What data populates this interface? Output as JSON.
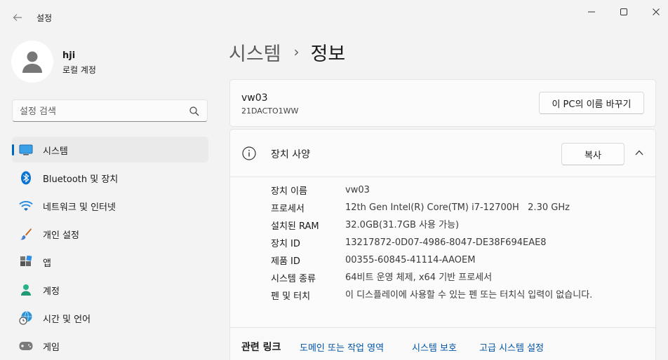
{
  "window": {
    "title": "설정"
  },
  "profile": {
    "name": "hji",
    "account_type": "로컬 계정"
  },
  "search": {
    "placeholder": "설정 검색"
  },
  "sidebar": {
    "items": [
      {
        "label": "시스템",
        "icon": "monitor-icon",
        "active": true
      },
      {
        "label": "Bluetooth 및 장치",
        "icon": "bluetooth-icon"
      },
      {
        "label": "네트워크 및 인터넷",
        "icon": "wifi-icon"
      },
      {
        "label": "개인 설정",
        "icon": "paintbrush-icon"
      },
      {
        "label": "앱",
        "icon": "apps-icon"
      },
      {
        "label": "계정",
        "icon": "person-icon"
      },
      {
        "label": "시간 및 언어",
        "icon": "globe-clock-icon"
      },
      {
        "label": "게임",
        "icon": "gamepad-icon"
      }
    ]
  },
  "breadcrumb": {
    "parent": "시스템",
    "separator": "›",
    "current": "정보"
  },
  "pc": {
    "name": "vw03",
    "model": "21DACTO1WW",
    "rename_label": "이 PC의 이름 바꾸기"
  },
  "device_specs": {
    "title": "장치 사양",
    "copy_label": "복사",
    "rows": [
      {
        "label": "장치 이름",
        "value": "vw03"
      },
      {
        "label": "프로세서",
        "value": "12th Gen Intel(R) Core(TM) i7-12700H   2.30 GHz"
      },
      {
        "label": "설치된 RAM",
        "value": "32.0GB(31.7GB 사용 가능)"
      },
      {
        "label": "장치 ID",
        "value": "13217872-0D07-4986-8047-DE38F694EAE8"
      },
      {
        "label": "제품 ID",
        "value": "00355-60845-41114-AAOEM"
      },
      {
        "label": "시스템 종류",
        "value": "64비트 운영 체제, x64 기반 프로세서"
      },
      {
        "label": "펜 및 터치",
        "value": "이 디스플레이에 사용할 수 있는 펜 또는 터치식 입력이 없습니다."
      }
    ]
  },
  "related_links": {
    "title": "관련 링크",
    "links": [
      "도메인 또는 작업 영역",
      "시스템 보호",
      "고급 시스템 설정"
    ]
  },
  "colors": {
    "accent": "#0067c0",
    "background": "#f3f3f3",
    "card": "#fbfbfb",
    "link": "#0054a6"
  }
}
